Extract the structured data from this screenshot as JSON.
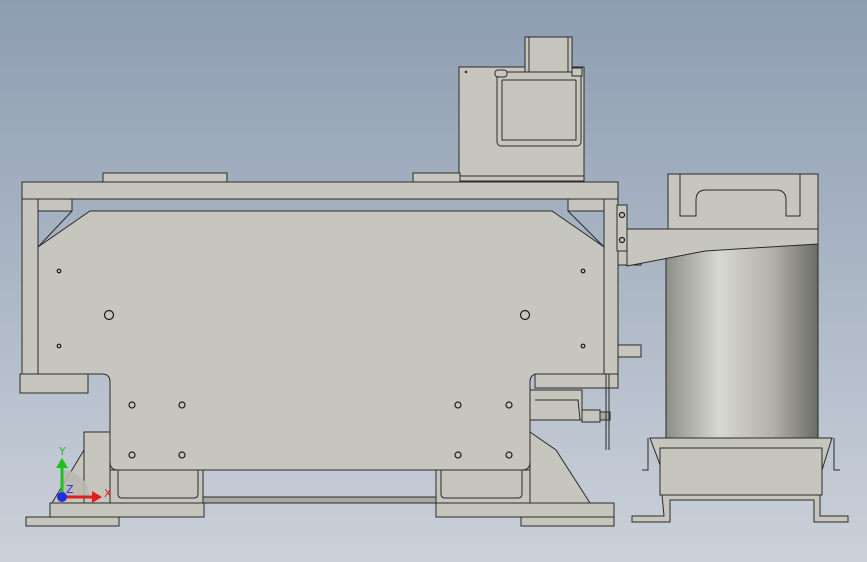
{
  "viewport": {
    "background_top": "#8d9db1",
    "background_bottom": "#c9cfd8",
    "model_fill": "#c6c6bf",
    "edge_color": "#2a2a2a"
  },
  "triad": {
    "x_label": "X",
    "y_label": "Y",
    "z_label": "Z",
    "x_color": "#e01e1e",
    "y_color": "#1ec21e",
    "z_color": "#1e2ee0"
  }
}
